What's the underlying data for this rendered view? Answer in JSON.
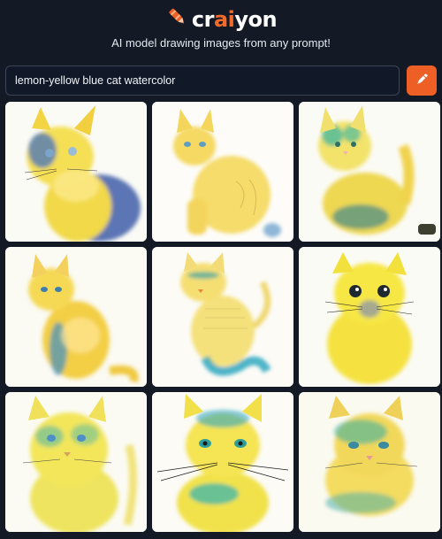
{
  "header": {
    "logo_prefix": "cr",
    "logo_accent": "ai",
    "logo_suffix": "yon",
    "tagline": "AI model drawing images from any prompt!"
  },
  "prompt": {
    "value": "lemon-yellow blue cat watercolor",
    "button_icon": "pencil-icon"
  },
  "colors": {
    "background": "#131a26",
    "accent": "#ee5f26",
    "cat_yellow": "#f3dd3c",
    "cat_blue": "#3f6fb5",
    "cat_teal": "#3fa7a0"
  },
  "images": [
    {
      "subject": "cat-watercolor",
      "variant": 1
    },
    {
      "subject": "cat-watercolor",
      "variant": 2
    },
    {
      "subject": "cat-watercolor",
      "variant": 3
    },
    {
      "subject": "cat-watercolor",
      "variant": 4
    },
    {
      "subject": "cat-watercolor",
      "variant": 5
    },
    {
      "subject": "cat-watercolor",
      "variant": 6
    },
    {
      "subject": "cat-watercolor",
      "variant": 7
    },
    {
      "subject": "cat-watercolor",
      "variant": 8
    },
    {
      "subject": "cat-watercolor",
      "variant": 9
    }
  ]
}
